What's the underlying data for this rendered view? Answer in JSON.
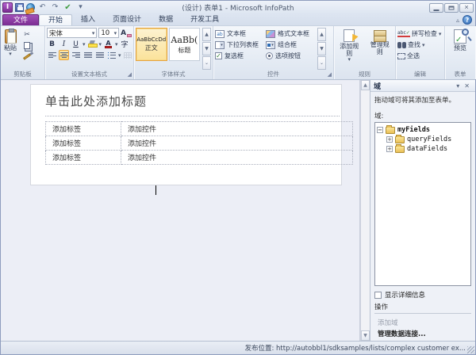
{
  "window": {
    "title": "(设计) 表单1 - Microsoft InfoPath",
    "app_initial": "I",
    "help": "?",
    "collapse_ribbon": "▵",
    "maximize_glyph": "",
    "close_glyph": "✕"
  },
  "icons": {
    "caret_down": "▾",
    "arrow_up": "▲",
    "arrow_down": "▼",
    "more": "⌄",
    "scissors": "✂",
    "undo": "↶",
    "redo": "↷",
    "design_check": "✔",
    "check": "✓",
    "launcher": "◢",
    "plus": "+",
    "minus": "−",
    "abc": "abc"
  },
  "tabs": [
    {
      "label": "文件"
    },
    {
      "label": "开始"
    },
    {
      "label": "插入"
    },
    {
      "label": "页面设计"
    },
    {
      "label": "数据"
    },
    {
      "label": "开发工具"
    }
  ],
  "ribbon": {
    "clipboard": {
      "label": "剪贴板",
      "paste": "粘贴"
    },
    "format_text": {
      "label": "设置文本格式",
      "font_name": "宋体",
      "font_size": "10",
      "bold": "B",
      "italic": "I",
      "underline": "U",
      "char_button": "字",
      "font_color_letter": "A",
      "clear_letter": "A"
    },
    "font_styles": {
      "label": "字体样式",
      "styles": [
        {
          "preview": "AaBbCcDd",
          "name": "正文"
        },
        {
          "preview": "AaBb(",
          "name": "标题"
        }
      ]
    },
    "controls": {
      "label": "控件",
      "col1": [
        {
          "label": "文本框"
        },
        {
          "label": "下拉列表框"
        },
        {
          "label": "复选框"
        }
      ],
      "col2": [
        {
          "label": "格式文本框"
        },
        {
          "label": "组合框"
        },
        {
          "label": "选项按钮"
        }
      ]
    },
    "rules": {
      "label": "规则",
      "add": "添加规则",
      "manage": "管理规则"
    },
    "editing": {
      "label": "编辑",
      "spelling": "拼写检查",
      "find": "查找",
      "select_all": "全选"
    },
    "form": {
      "label": "表单",
      "preview": "预览"
    }
  },
  "canvas": {
    "page_title_placeholder": "单击此处添加标题",
    "table": {
      "rows": [
        {
          "label": "添加标签",
          "control": "添加控件"
        },
        {
          "label": "添加标签",
          "control": "添加控件"
        },
        {
          "label": "添加标签",
          "control": "添加控件"
        }
      ]
    }
  },
  "fields_pane": {
    "title": "域",
    "hint": "拖动域可将其添加至表单。",
    "fields_label": "域:",
    "tree": {
      "root": "myFields",
      "child1": "queryFields",
      "child2": "dataFields"
    },
    "show_details": "显示详细信息",
    "actions_label": "操作",
    "add_field": "添加域",
    "manage_connections": "管理数据连接..."
  },
  "status_bar": {
    "publish_location": "发布位置: http://autobbl1/sdksamples/lists/complex customer ex..."
  }
}
